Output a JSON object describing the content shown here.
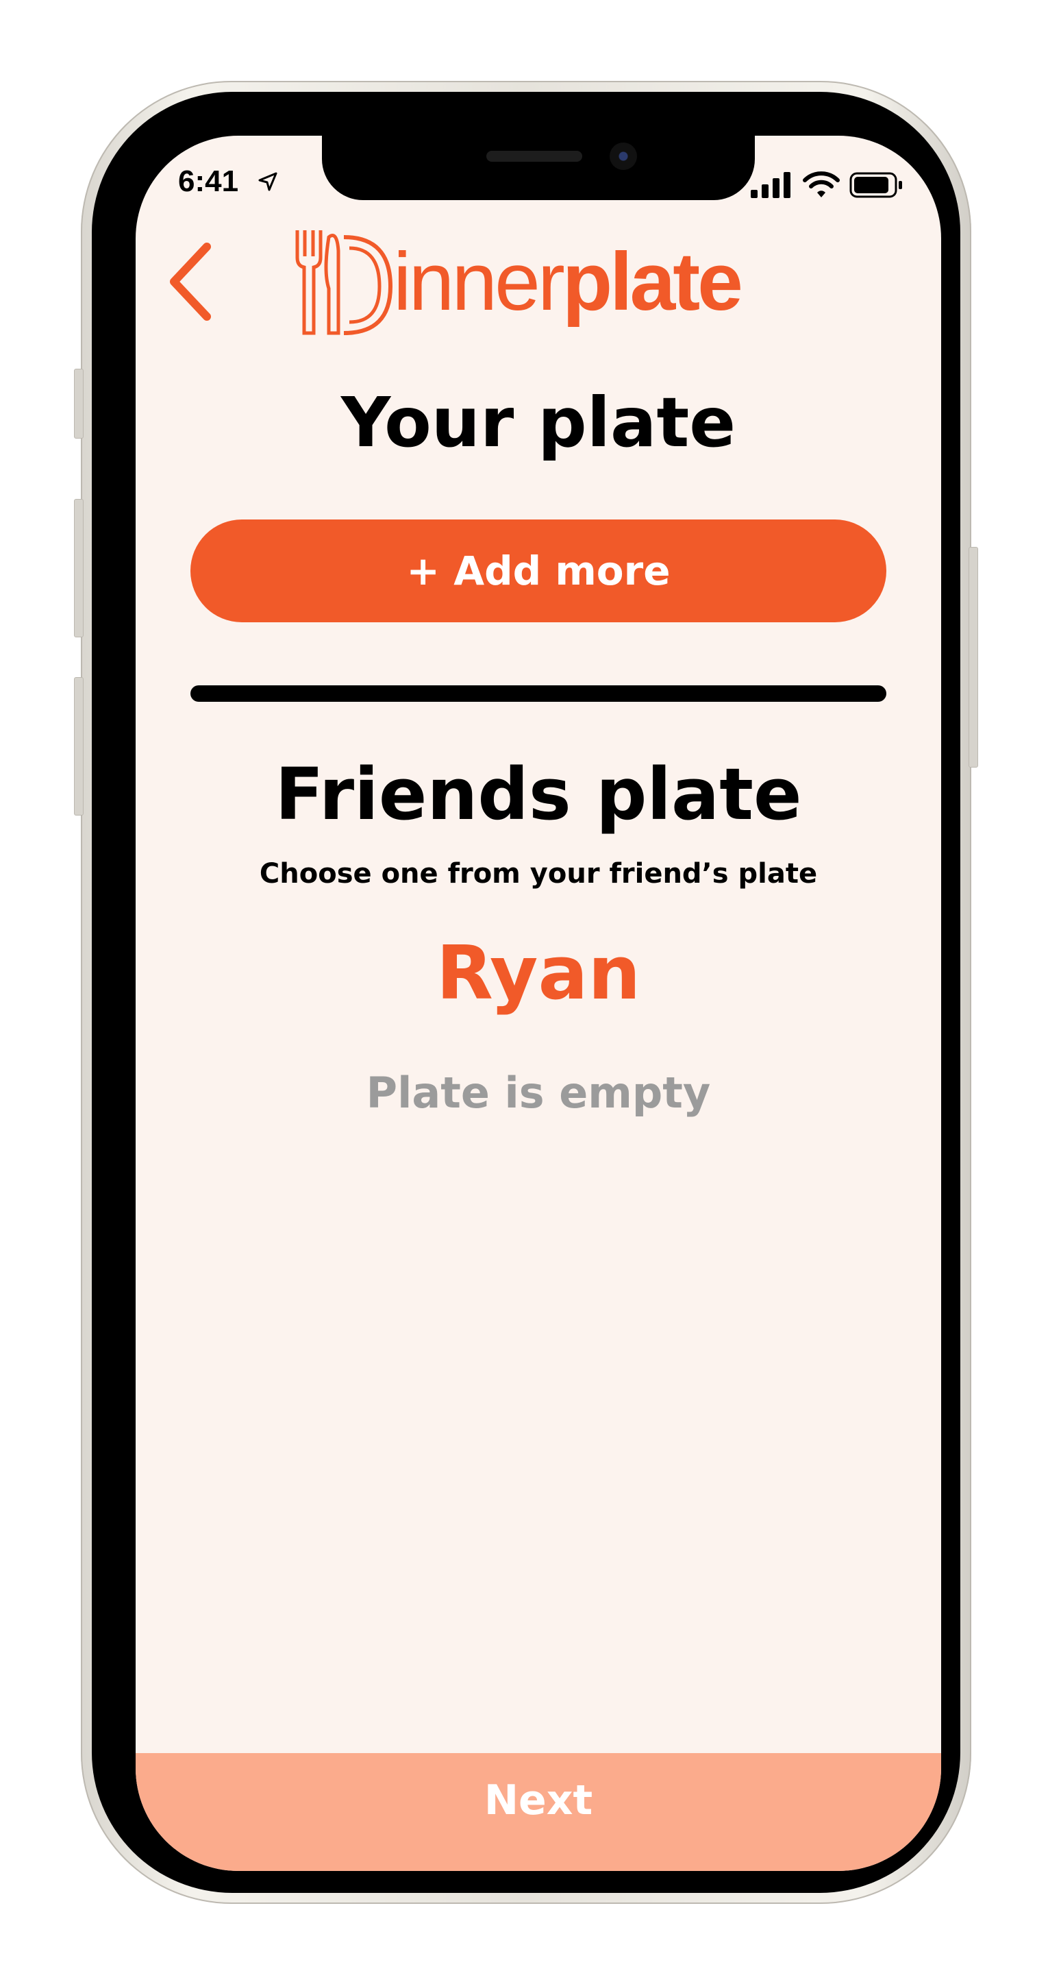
{
  "colors": {
    "accent": "#f15a29",
    "screen_background": "#fcf3ee",
    "next_bar": "#fbab8c",
    "muted_text": "#9b9b9b"
  },
  "status_bar": {
    "time": "6:41",
    "icons": [
      "location-arrow-icon",
      "cellular-signal-icon",
      "wifi-icon",
      "battery-icon"
    ]
  },
  "header": {
    "back_icon": "chevron-left-icon",
    "logo_icon": "fork-knife-plate-icon",
    "logo_text_light": "innerplate",
    "logo_text_light_prefix": "inner",
    "logo_text_bold": "plate"
  },
  "your_plate": {
    "title": "Your plate",
    "add_button_label": "+ Add more"
  },
  "friends_plate": {
    "title": "Friends plate",
    "subtitle": "Choose one from your friend’s plate",
    "friend_name": "Ryan",
    "empty_message": "Plate is empty"
  },
  "footer": {
    "next_label": "Next"
  }
}
